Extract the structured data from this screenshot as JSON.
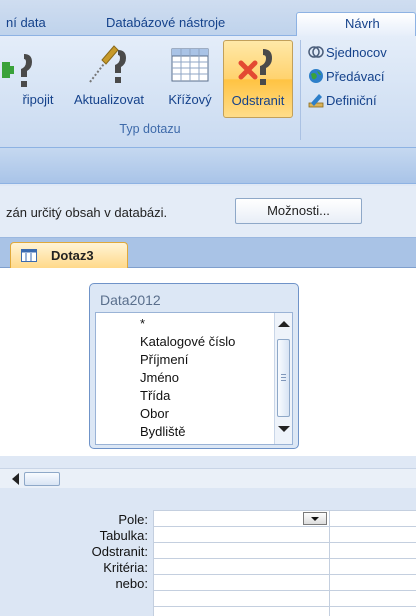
{
  "ribbon_tabs": [
    {
      "label": "ní data"
    },
    {
      "label": "Databázové nástroje"
    },
    {
      "label": "Návrh"
    }
  ],
  "ribbon_buttons": {
    "append": "řipojit",
    "update": "Aktualizovat",
    "crosstab": "Křížový",
    "delete": "Odstranit"
  },
  "ribbon_group_label": "Typ dotazu",
  "ribbon_small": {
    "union": "Sjednocov",
    "passthrough": "Předávací",
    "data_definition": "Definiční"
  },
  "message_bar": {
    "text": "zán určitý obsah v databázi.",
    "button": "Možnosti..."
  },
  "doc_tab": {
    "label": "Dotaz3"
  },
  "table": {
    "title": "Data2012",
    "fields": [
      "*",
      "Katalogové číslo",
      "Příjmení",
      "Jméno",
      "Třída",
      "Obor",
      "Bydliště"
    ]
  },
  "grid_rows": {
    "field": "Pole:",
    "table": "Tabulka:",
    "delete": "Odstranit:",
    "criteria": "Kritéria:",
    "or": "nebo:"
  },
  "colors": {
    "accent": "#15428b",
    "active_button": "#ffd26e",
    "delete_icon": "#e34a32",
    "insert_icon": "#3aa23a"
  }
}
